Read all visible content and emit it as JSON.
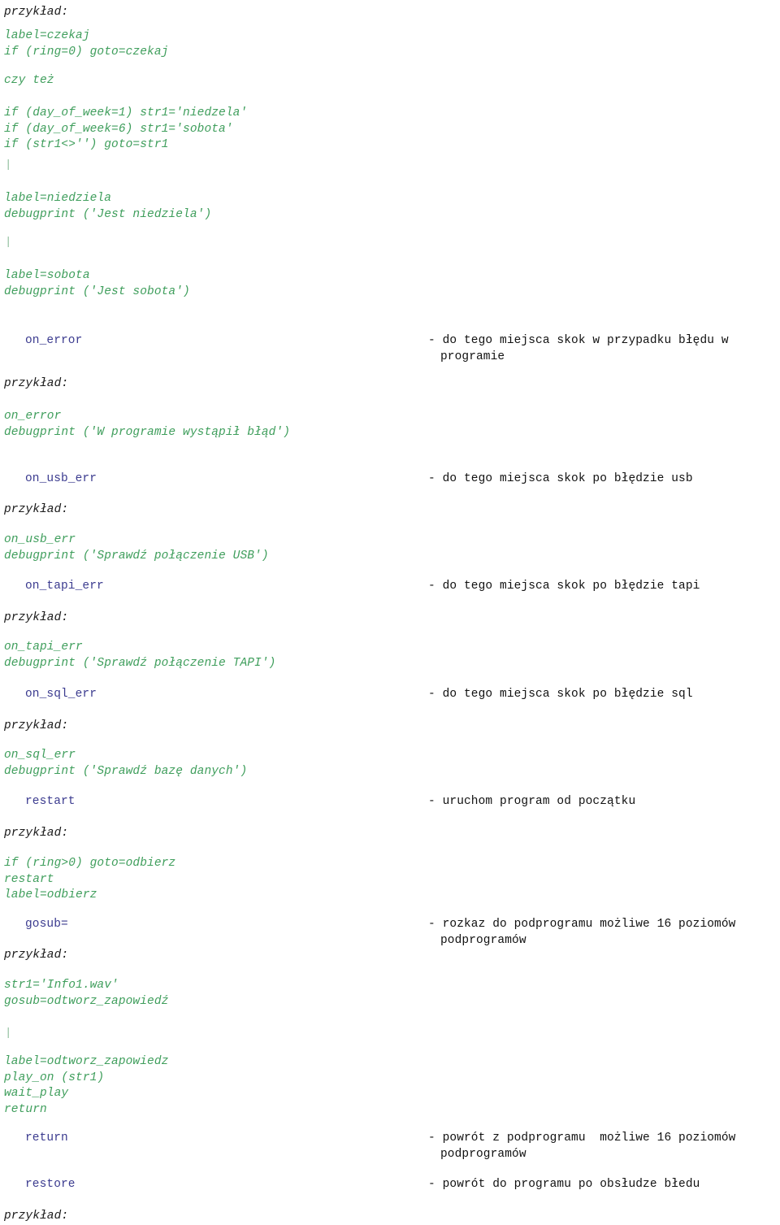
{
  "document": {
    "language": "pl",
    "colors": {
      "code_green": "#3f9e5c",
      "term_navy": "#3b3b8f",
      "body_black": "#111111",
      "page_background": "#ffffff"
    },
    "example_label": "przykład:",
    "separator_glyph": "|"
  },
  "blocks": {
    "example_top_label": "przykład:",
    "code_czekaj": "label=czekaj\nif (ring=0) goto=czekaj",
    "czy_tez": "czy też",
    "code_day_of_week": "if (day_of_week=1) str1='niedzela'\nif (day_of_week=6) str1='sobota'\nif (str1<>'') goto=str1",
    "sep_1": "|",
    "code_niedziela": "label=niedziela\ndebugprint ('Jest niedziela')",
    "sep_2": "|",
    "code_sobota": "label=sobota\ndebugprint ('Jest sobota')",
    "example_label_on_error": "przykład:",
    "code_on_error": "on_error\ndebugprint ('W programie wystąpił błąd')",
    "example_label_on_usb_err": "przykład:",
    "code_on_usb_err": "on_usb_err\ndebugprint ('Sprawdź połączenie USB')",
    "example_label_on_tapi_err": "przykład:",
    "code_on_tapi_err": "on_tapi_err\ndebugprint ('Sprawdź połączenie TAPI')",
    "example_label_on_sql_err": "przykład:",
    "code_on_sql_err": "on_sql_err\ndebugprint ('Sprawdź bazę danych')",
    "example_label_restart": "przykład:",
    "code_restart": "if (ring>0) goto=odbierz\nrestart\nlabel=odbierz",
    "example_label_gosub": "przykład:",
    "code_gosub_1": "str1='Info1.wav'\ngosub=odtworz_zapowiedź",
    "sep_3": "|",
    "code_gosub_2": "label=odtworz_zapowiedz\nplay_on (str1)\nwait_play\nreturn",
    "example_label_bottom": "przykład:"
  },
  "entries": [
    {
      "term": "on_error",
      "description": "- do tego miejsca skok w przypadku błędu w",
      "description_cont": "programie"
    },
    {
      "term": "on_usb_err",
      "description": "- do tego miejsca skok po błędzie usb",
      "description_cont": ""
    },
    {
      "term": "on_tapi_err",
      "description": "- do tego miejsca skok po błędzie tapi",
      "description_cont": ""
    },
    {
      "term": "on_sql_err",
      "description": "- do tego miejsca skok po błędzie sql",
      "description_cont": ""
    },
    {
      "term": "restart",
      "description": "- uruchom program od początku",
      "description_cont": ""
    },
    {
      "term": "gosub=",
      "description": "- rozkaz do podprogramu możliwe 16 poziomów",
      "description_cont": "podprogramów"
    },
    {
      "term": "return",
      "description": "- powrót z podprogramu  możliwe 16 poziomów",
      "description_cont": "podprogramów"
    },
    {
      "term": "restore",
      "description": "- powrót do programu po obsłudze błedu",
      "description_cont": ""
    }
  ]
}
